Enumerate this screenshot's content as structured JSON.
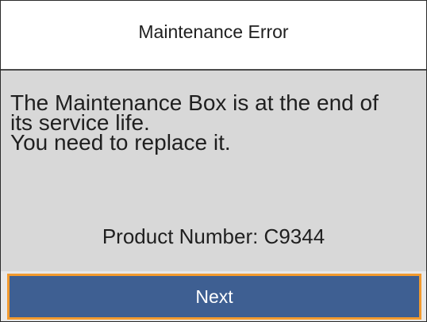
{
  "title": "Maintenance Error",
  "message": {
    "lines": [
      "The Maintenance Box is at the end of",
      "its service life.",
      "You need to replace it."
    ]
  },
  "product": {
    "label": "Product Number: C9344"
  },
  "buttons": {
    "next_label": "Next"
  },
  "colors": {
    "title_background": "#ffffff",
    "body_background": "#d8d8d8",
    "button_fill": "#3e5f92",
    "button_focus_border": "#f29a2e",
    "text": "#1f1f1f"
  }
}
